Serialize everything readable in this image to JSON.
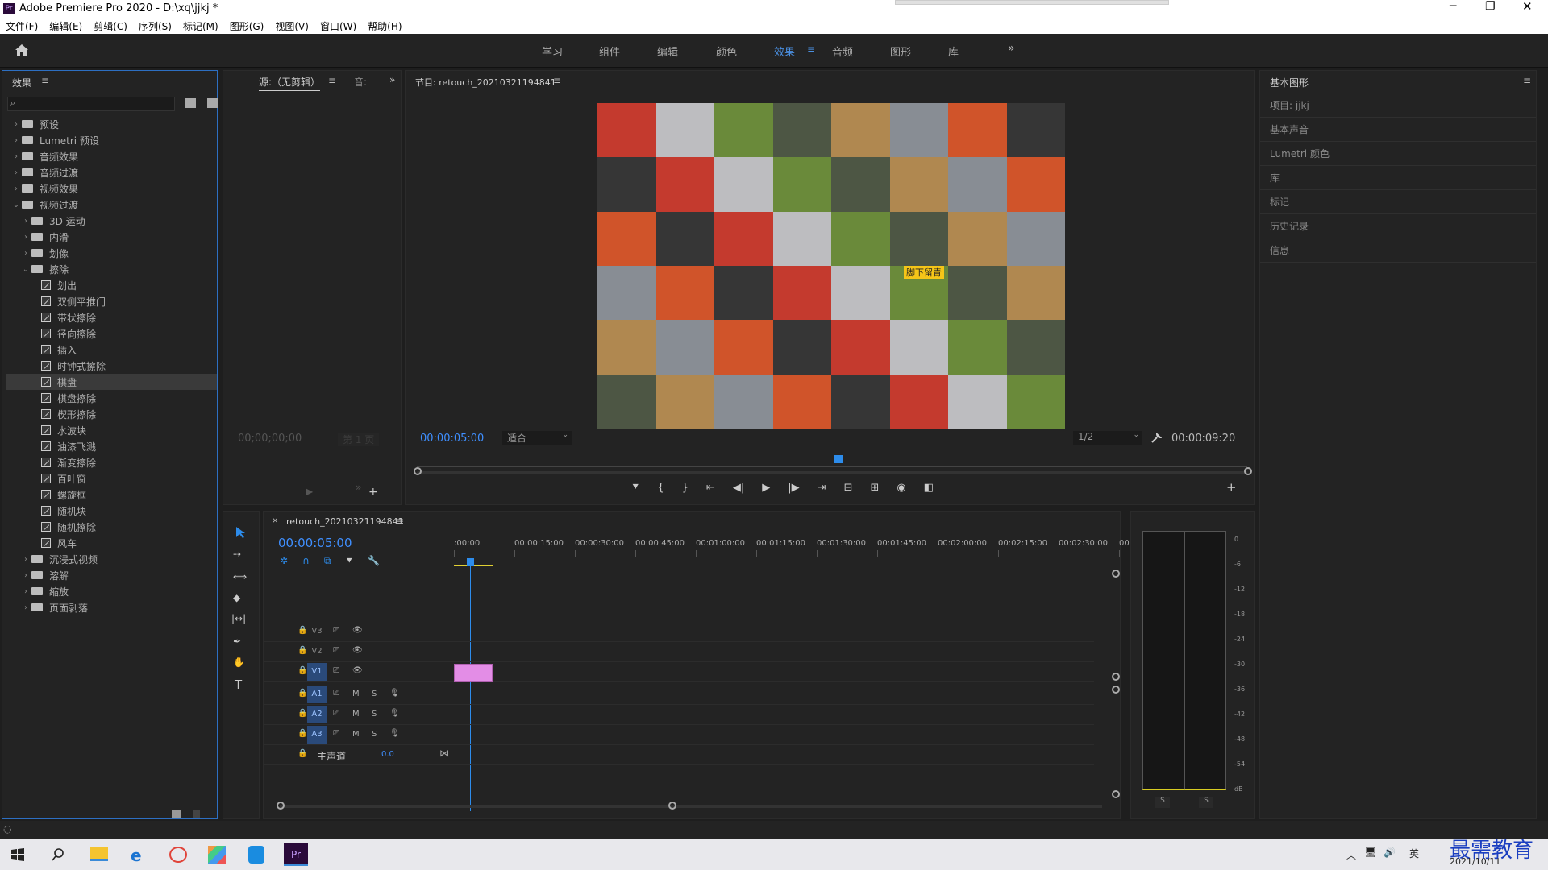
{
  "window": {
    "title": "Adobe Premiere Pro 2020 - D:\\xq\\jjkj *"
  },
  "menu": [
    "文件(F)",
    "编辑(E)",
    "剪辑(C)",
    "序列(S)",
    "标记(M)",
    "图形(G)",
    "视图(V)",
    "窗口(W)",
    "帮助(H)"
  ],
  "workspaces": [
    "学习",
    "组件",
    "编辑",
    "颜色",
    "效果",
    "音频",
    "图形",
    "库"
  ],
  "active_workspace": "效果",
  "effects_panel": {
    "title": "效果",
    "search_placeholder": "",
    "tree": [
      {
        "label": "预设",
        "level": 0,
        "type": "folder",
        "expanded": false
      },
      {
        "label": "Lumetri 预设",
        "level": 0,
        "type": "folder",
        "expanded": false
      },
      {
        "label": "音频效果",
        "level": 0,
        "type": "folder",
        "expanded": false
      },
      {
        "label": "音频过渡",
        "level": 0,
        "type": "folder",
        "expanded": false
      },
      {
        "label": "视频效果",
        "level": 0,
        "type": "folder",
        "expanded": false
      },
      {
        "label": "视频过渡",
        "level": 0,
        "type": "folder",
        "expanded": true
      },
      {
        "label": "3D 运动",
        "level": 1,
        "type": "folder",
        "expanded": false
      },
      {
        "label": "内滑",
        "level": 1,
        "type": "folder",
        "expanded": false
      },
      {
        "label": "划像",
        "level": 1,
        "type": "folder",
        "expanded": false
      },
      {
        "label": "擦除",
        "level": 1,
        "type": "folder",
        "expanded": true
      },
      {
        "label": "划出",
        "level": 2,
        "type": "fx"
      },
      {
        "label": "双侧平推门",
        "level": 2,
        "type": "fx"
      },
      {
        "label": "带状擦除",
        "level": 2,
        "type": "fx"
      },
      {
        "label": "径向擦除",
        "level": 2,
        "type": "fx"
      },
      {
        "label": "插入",
        "level": 2,
        "type": "fx"
      },
      {
        "label": "时钟式擦除",
        "level": 2,
        "type": "fx"
      },
      {
        "label": "棋盘",
        "level": 2,
        "type": "fx",
        "selected": true
      },
      {
        "label": "棋盘擦除",
        "level": 2,
        "type": "fx"
      },
      {
        "label": "楔形擦除",
        "level": 2,
        "type": "fx"
      },
      {
        "label": "水波块",
        "level": 2,
        "type": "fx"
      },
      {
        "label": "油漆飞溅",
        "level": 2,
        "type": "fx"
      },
      {
        "label": "渐变擦除",
        "level": 2,
        "type": "fx"
      },
      {
        "label": "百叶窗",
        "level": 2,
        "type": "fx"
      },
      {
        "label": "螺旋框",
        "level": 2,
        "type": "fx"
      },
      {
        "label": "随机块",
        "level": 2,
        "type": "fx"
      },
      {
        "label": "随机擦除",
        "level": 2,
        "type": "fx"
      },
      {
        "label": "风车",
        "level": 2,
        "type": "fx"
      },
      {
        "label": "沉浸式视频",
        "level": 1,
        "type": "folder",
        "expanded": false
      },
      {
        "label": "溶解",
        "level": 1,
        "type": "folder",
        "expanded": false
      },
      {
        "label": "缩放",
        "level": 1,
        "type": "folder",
        "expanded": false
      },
      {
        "label": "页面剥落",
        "level": 1,
        "type": "folder",
        "expanded": false
      }
    ]
  },
  "source_panel": {
    "tab": "源:（无剪辑）",
    "tab2": "音:",
    "timecode": "00;00;00;00",
    "page": "第 1 页"
  },
  "program_panel": {
    "title": "节目: retouch_20210321194841",
    "timecode": "00:00:05:00",
    "fit": "适合",
    "resolution": "1/2",
    "duration": "00:00:09:20",
    "image_text": "脚下留青"
  },
  "right_panel": {
    "title": "基本图形",
    "items": [
      "项目: jjkj",
      "基本声音",
      "Lumetri 颜色",
      "库",
      "标记",
      "历史记录",
      "信息"
    ]
  },
  "timeline": {
    "sequence": "retouch_20210321194841",
    "timecode": "00:00:05:00",
    "ruler": [
      ":00:00",
      "00:00:15:00",
      "00:00:30:00",
      "00:00:45:00",
      "00:01:00:00",
      "00:01:15:00",
      "00:01:30:00",
      "00:01:45:00",
      "00:02:00:00",
      "00:02:15:00",
      "00:02:30:00",
      "00:"
    ],
    "video_tracks": [
      "V3",
      "V2",
      "V1"
    ],
    "audio_tracks": [
      "A1",
      "A2",
      "A3"
    ],
    "master": "主声道",
    "master_value": "0.0",
    "mute": "M",
    "solo": "S"
  },
  "meter": {
    "scale": [
      "0",
      "-6",
      "-12",
      "-18",
      "-24",
      "-30",
      "-36",
      "-42",
      "-48",
      "-54",
      "dB"
    ],
    "solo": [
      "S",
      "S"
    ]
  },
  "taskbar": {
    "ime": "英",
    "date": "2021/10/11",
    "watermark": "最需教育"
  },
  "colors": {
    "accent": "#2d8ceb",
    "clip": "#e38de6",
    "selection": "#3a3a3a"
  }
}
